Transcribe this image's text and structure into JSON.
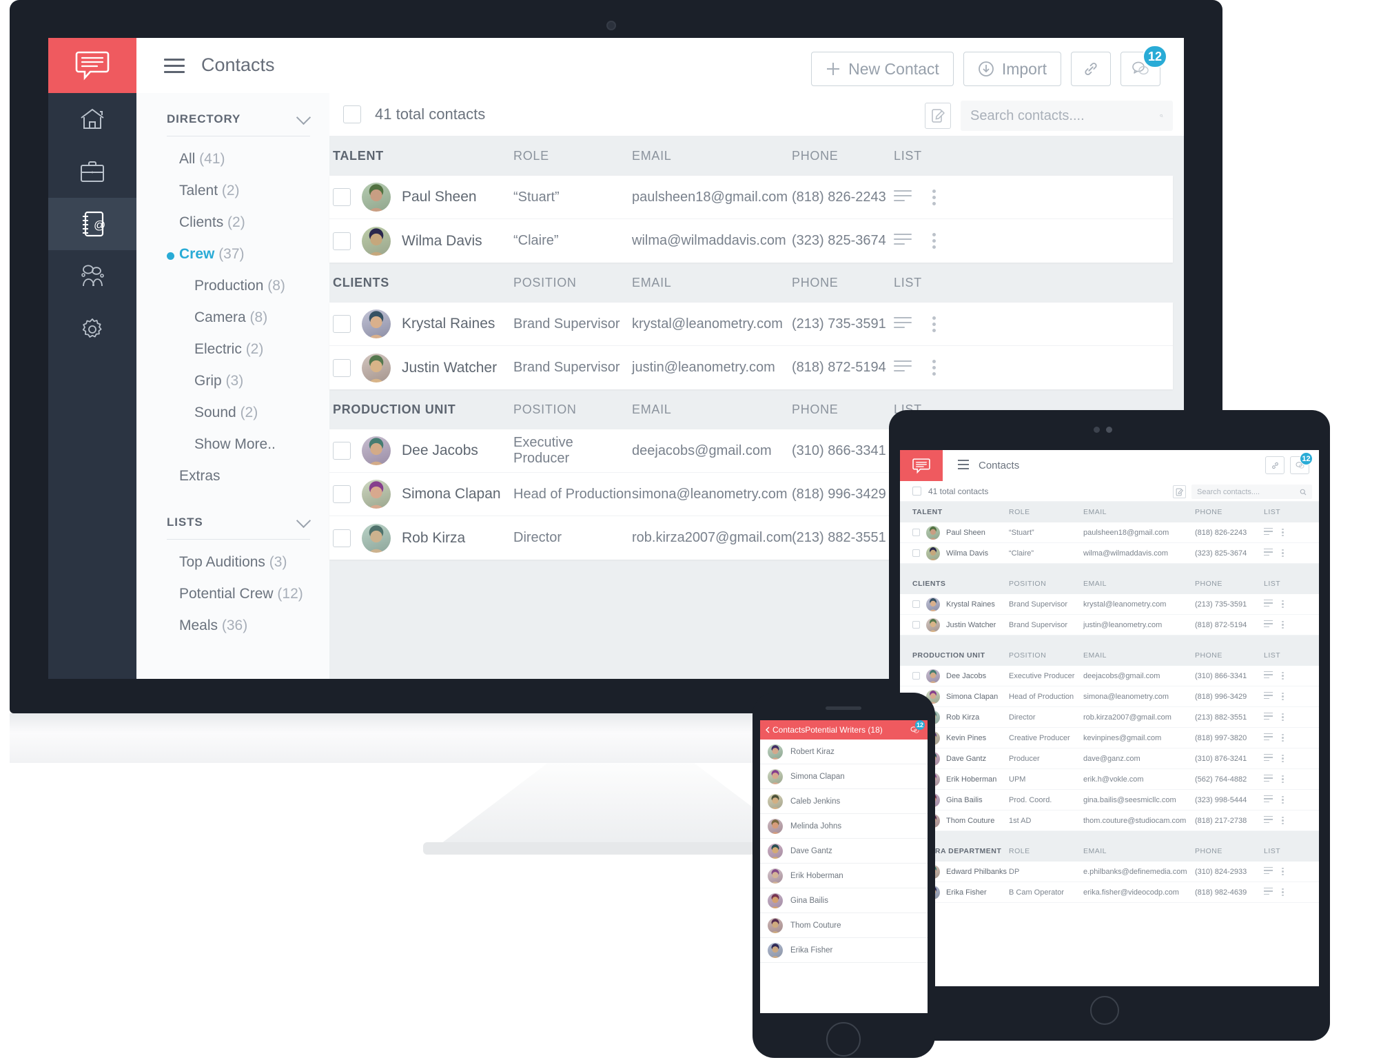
{
  "brand": {
    "accent_red": "#ef5a5f",
    "accent_blue": "#29abd6",
    "dark": "#2b3442",
    "logo_icon": "speech-bubble-icon"
  },
  "desktop": {
    "header": {
      "title": "Contacts",
      "menu_icon": "hamburger-icon",
      "buttons": [
        {
          "label": "New Contact",
          "icon": "plus-icon"
        },
        {
          "label": "Import",
          "icon": "download-circle-icon"
        }
      ],
      "link_button": {
        "icon": "link-icon"
      },
      "chat_button": {
        "icon": "chat-bubble-icon",
        "badge": "12"
      }
    },
    "rail": [
      {
        "name": "home",
        "icon": "home-icon",
        "active": false
      },
      {
        "name": "projects",
        "icon": "briefcase-icon",
        "active": false
      },
      {
        "name": "contacts",
        "icon": "address-book-icon",
        "active": true
      },
      {
        "name": "team",
        "icon": "people-icon",
        "active": false
      },
      {
        "name": "settings",
        "icon": "gear-icon",
        "active": false
      }
    ],
    "directory": {
      "label": "DIRECTORY",
      "chevron": "chevron-down-icon",
      "items": [
        {
          "label": "All",
          "count": "(41)",
          "sub": false,
          "active": false
        },
        {
          "label": "Talent",
          "count": "(2)",
          "sub": false,
          "active": false
        },
        {
          "label": "Clients",
          "count": "(2)",
          "sub": false,
          "active": false
        },
        {
          "label": "Crew",
          "count": "(37)",
          "sub": false,
          "active": true
        },
        {
          "label": "Production",
          "count": "(8)",
          "sub": true,
          "active": false
        },
        {
          "label": "Camera",
          "count": "(8)",
          "sub": true,
          "active": false
        },
        {
          "label": "Electric",
          "count": "(2)",
          "sub": true,
          "active": false
        },
        {
          "label": "Grip",
          "count": "(3)",
          "sub": true,
          "active": false
        },
        {
          "label": "Sound",
          "count": "(2)",
          "sub": true,
          "active": false
        },
        {
          "label": "Show More..",
          "count": "",
          "sub": true,
          "active": false
        },
        {
          "label": "Extras",
          "count": "",
          "sub": false,
          "active": false
        }
      ]
    },
    "lists": {
      "label": "LISTS",
      "chevron": "chevron-down-icon",
      "items": [
        {
          "label": "Top Auditions",
          "count": "(3)"
        },
        {
          "label": "Potential Crew",
          "count": "(12)"
        },
        {
          "label": "Meals",
          "count": "(36)"
        }
      ]
    },
    "toolbar": {
      "total_contacts": "41 total contacts",
      "note_icon": "note-edit-icon",
      "search_placeholder": "Search contacts....",
      "search_value": "",
      "search_icon": "search-icon"
    },
    "groups": [
      {
        "headers": [
          "TALENT",
          "ROLE",
          "EMAIL",
          "PHONE",
          "LIST"
        ],
        "rows": [
          {
            "name": "Paul Sheen",
            "role": "“Stuart”",
            "email": "paulsheen18@gmail.com",
            "phone": "(818) 826-2243"
          },
          {
            "name": "Wilma Davis",
            "role": "“Claire”",
            "email": "wilma@wilmaddavis.com",
            "phone": "(323) 825-3674"
          }
        ]
      },
      {
        "headers": [
          "CLIENTS",
          "POSITION",
          "EMAIL",
          "PHONE",
          "LIST"
        ],
        "rows": [
          {
            "name": "Krystal Raines",
            "role": "Brand Supervisor",
            "email": "krystal@leanometry.com",
            "phone": "(213) 735-3591"
          },
          {
            "name": "Justin Watcher",
            "role": "Brand Supervisor",
            "email": "justin@leanometry.com",
            "phone": "(818) 872-5194"
          }
        ]
      },
      {
        "headers": [
          "PRODUCTION UNIT",
          "POSITION",
          "EMAIL",
          "PHONE",
          "LIST"
        ],
        "rows": [
          {
            "name": "Dee Jacobs",
            "role": "Executive Producer",
            "email": "deejacobs@gmail.com",
            "phone": "(310) 866-3341"
          },
          {
            "name": "Simona Clapan",
            "role": "Head of Production",
            "email": "simona@leanometry.com",
            "phone": "(818) 996-3429"
          },
          {
            "name": "Rob Kirza",
            "role": "Director",
            "email": "rob.kirza2007@gmail.com",
            "phone": "(213) 882-3551"
          }
        ]
      }
    ]
  },
  "tablet": {
    "header": {
      "title": "Contacts",
      "menu_icon": "hamburger-icon",
      "link_icon": "link-icon",
      "chat_icon": "chat-bubble-icon",
      "badge": "12"
    },
    "toolbar": {
      "total_contacts": "41 total contacts",
      "note_icon": "note-edit-icon",
      "search_placeholder": "Search contacts....",
      "search_icon": "search-icon"
    },
    "groups": [
      {
        "headers": [
          "TALENT",
          "ROLE",
          "EMAIL",
          "PHONE",
          "LIST"
        ],
        "rows": [
          {
            "name": "Paul Sheen",
            "role": "“Stuart”",
            "email": "paulsheen18@gmail.com",
            "phone": "(818) 826-2243"
          },
          {
            "name": "Wilma Davis",
            "role": "“Claire”",
            "email": "wilma@wilmaddavis.com",
            "phone": "(323) 825-3674"
          }
        ]
      },
      {
        "headers": [
          "CLIENTS",
          "POSITION",
          "EMAIL",
          "PHONE",
          "LIST"
        ],
        "rows": [
          {
            "name": "Krystal Raines",
            "role": "Brand Supervisor",
            "email": "krystal@leanometry.com",
            "phone": "(213) 735-3591"
          },
          {
            "name": "Justin Watcher",
            "role": "Brand Supervisor",
            "email": "justin@leanometry.com",
            "phone": "(818) 872-5194"
          }
        ]
      },
      {
        "headers": [
          "PRODUCTION UNIT",
          "POSITION",
          "EMAIL",
          "PHONE",
          "LIST"
        ],
        "rows": [
          {
            "name": "Dee Jacobs",
            "role": "Executive Producer",
            "email": "deejacobs@gmail.com",
            "phone": "(310) 866-3341"
          },
          {
            "name": "Simona Clapan",
            "role": "Head of Production",
            "email": "simona@leanometry.com",
            "phone": "(818) 996-3429"
          },
          {
            "name": "Rob Kirza",
            "role": "Director",
            "email": "rob.kirza2007@gmail.com",
            "phone": "(213) 882-3551"
          },
          {
            "name": "Kevin Pines",
            "role": "Creative Producer",
            "email": "kevinpines@gmail.com",
            "phone": "(818) 997-3820"
          },
          {
            "name": "Dave Gantz",
            "role": "Producer",
            "email": "dave@ganz.com",
            "phone": "(310) 876-3241"
          },
          {
            "name": "Erik Hoberman",
            "role": "UPM",
            "email": "erik.h@vokle.com",
            "phone": "(562) 764-4882"
          },
          {
            "name": "Gina Bailis",
            "role": "Prod. Coord.",
            "email": "gina.bailis@seesmicllc.com",
            "phone": "(323) 998-5444"
          },
          {
            "name": "Thom Couture",
            "role": "1st AD",
            "email": "thom.couture@studiocam.com",
            "phone": "(818) 217-2738"
          }
        ]
      },
      {
        "headers": [
          "CAMERA DEPARTMENT",
          "ROLE",
          "EMAIL",
          "PHONE",
          "LIST"
        ],
        "rows": [
          {
            "name": "Edward Philbanks",
            "role": "DP",
            "email": "e.philbanks@definemedia.com",
            "phone": "(310) 824-2933"
          },
          {
            "name": "Erika Fisher",
            "role": "B Cam Operator",
            "email": "erika.fisher@videocodp.com",
            "phone": "(818) 982-4639"
          }
        ]
      }
    ]
  },
  "phone": {
    "nav": {
      "back_label": "Contacts",
      "back_icon": "chevron-left-icon",
      "title": "Potential Writers (18)",
      "chat_icon": "chat-bubble-icon",
      "badge": "12"
    },
    "rows": [
      {
        "name": "Robert Kiraz"
      },
      {
        "name": "Simona Clapan"
      },
      {
        "name": "Caleb Jenkins"
      },
      {
        "name": "Melinda Johns"
      },
      {
        "name": "Dave Gantz"
      },
      {
        "name": "Erik Hoberman"
      },
      {
        "name": "Gina Bailis"
      },
      {
        "name": "Thom Couture"
      },
      {
        "name": "Erika Fisher"
      }
    ]
  }
}
